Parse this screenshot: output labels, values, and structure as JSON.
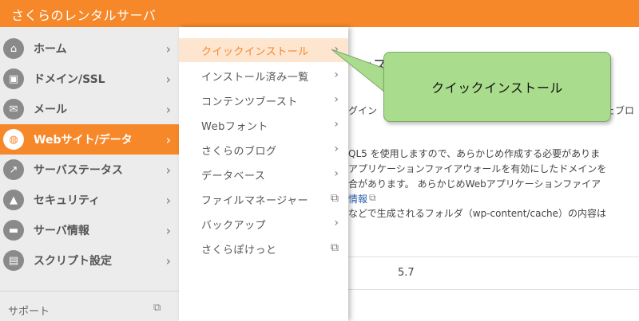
{
  "app": {
    "title": "さくらのレンタルサーバ"
  },
  "sidebar": {
    "items": [
      {
        "label": "ホーム",
        "icon": "home-icon",
        "active": false
      },
      {
        "label": "ドメイン/SSL",
        "icon": "lock-icon",
        "active": false
      },
      {
        "label": "メール",
        "icon": "mail-icon",
        "active": false
      },
      {
        "label": "Webサイト/データ",
        "icon": "globe-icon",
        "active": true
      },
      {
        "label": "サーバステータス",
        "icon": "chart-icon",
        "active": false
      },
      {
        "label": "セキュリティ",
        "icon": "lock-icon",
        "active": false
      },
      {
        "label": "サーバ情報",
        "icon": "server-icon",
        "active": false
      },
      {
        "label": "スクリプト設定",
        "icon": "script-icon",
        "active": false
      }
    ],
    "support_label": "サポート"
  },
  "submenu": {
    "items": [
      {
        "label": "クイックインストール",
        "kind": "chevron",
        "active": true
      },
      {
        "label": "インストール済み一覧",
        "kind": "chevron",
        "active": false
      },
      {
        "label": "コンテンツブースト",
        "kind": "chevron",
        "active": false
      },
      {
        "label": "Webフォント",
        "kind": "chevron",
        "active": false
      },
      {
        "label": "さくらのブログ",
        "kind": "chevron",
        "active": false
      },
      {
        "label": "データベース",
        "kind": "chevron",
        "active": false
      },
      {
        "label": "ファイルマネージャー",
        "kind": "external",
        "active": false
      },
      {
        "label": "バックアップ",
        "kind": "chevron",
        "active": false
      },
      {
        "label": "さくらぽけっと",
        "kind": "external",
        "active": false
      }
    ]
  },
  "content": {
    "heading": "ンス",
    "line1a": "グイン",
    "line1b": "ェブロ",
    "line2": "QL5 を使用しますので、あらかじめ作成する必要がありま",
    "line3": "アプリケーションファイアウォールを有効にしたドメインを",
    "line4": "合があります。 あらかじめWebアプリケーションファイア",
    "line5": "情報",
    "line6": "などで生成されるフォルダ（wp-content/cache）の内容は",
    "version": "5.7"
  },
  "callout": {
    "text": "クイックインストール"
  },
  "colors": {
    "accent": "#f6882a",
    "callout": "#a9dc8c",
    "active_sub_bg": "#fde5cf"
  }
}
